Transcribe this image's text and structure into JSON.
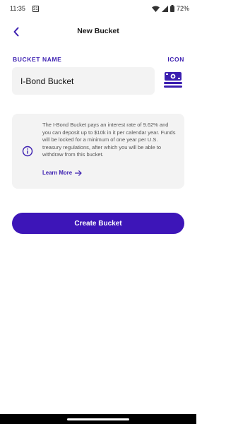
{
  "status_bar": {
    "time": "11:35",
    "calendar_date": "31",
    "battery": "72%",
    "icons": [
      "calendar-icon",
      "wifi-icon",
      "signal-icon",
      "battery-icon"
    ]
  },
  "header": {
    "title": "New Bucket",
    "back_icon": "chevron-left-icon"
  },
  "form": {
    "name_label": "BUCKET NAME",
    "icon_label": "ICON",
    "name_value": "I-Bond Bucket",
    "bucket_icon": "cash-stack-icon"
  },
  "info": {
    "text": "The I-Bond Bucket pays an interest rate of 9.62% and you can deposit up to $10k in it per calendar year. Funds will be locked for a minimum of one year per U.S. treasury regulations, after which you will be able to withdraw from this bucket.",
    "learn_more": "Learn More",
    "icon": "info-circle-icon"
  },
  "actions": {
    "create_label": "Create Bucket"
  },
  "colors": {
    "accent": "#3b1eb0",
    "button": "#3d15b8",
    "card_bg": "#f3f3f3"
  }
}
